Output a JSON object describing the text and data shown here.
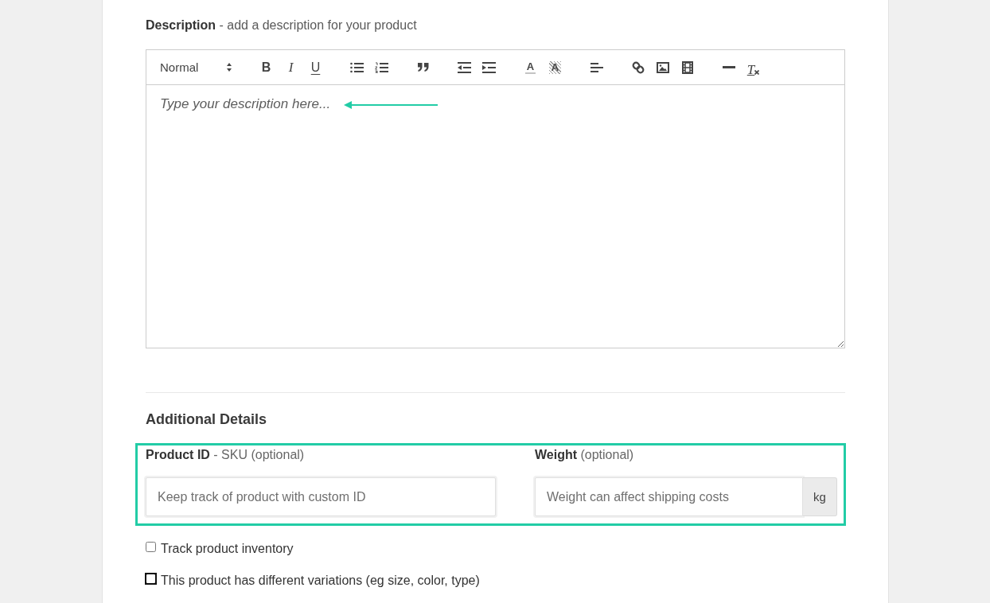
{
  "description": {
    "label": "**Description** - add a description for your product",
    "editor": {
      "toolbar": {
        "format": "Normal",
        "bold": "B",
        "italic": "I",
        "underline": "U",
        "text_color": "A",
        "background_color": "A",
        "clear_format": "T"
      },
      "placeholder": "Type your description here...",
      "arrow_annotation": true
    }
  },
  "additional_details": {
    "heading": "Additional Details",
    "field_row": {
      "highlighted": true,
      "fields": [
        {
          "label": "**Product ID** - SKU (optional)",
          "placeholder": "Keep track of product with custom ID"
        },
        {
          "label": "**Weight** (optional)",
          "placeholder": "Weight can affect shipping costs",
          "unit": "kg"
        }
      ]
    },
    "options": [
      {
        "label": "Track product inventory",
        "checked": false,
        "focused": false
      },
      {
        "label": "This product has different variations (eg size, color, type)",
        "checked": false,
        "focused": true
      }
    ]
  }
}
